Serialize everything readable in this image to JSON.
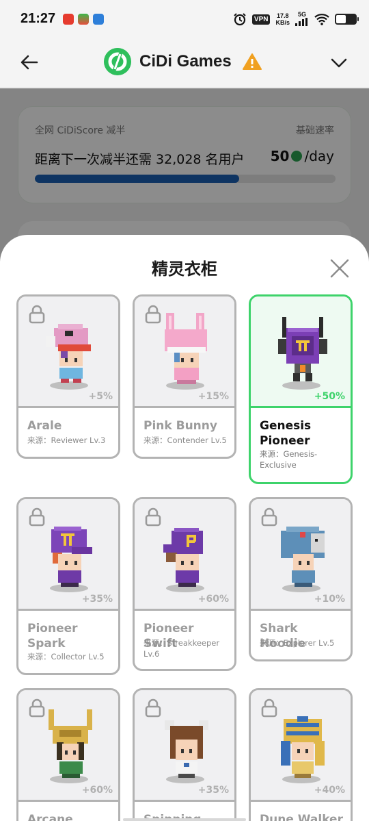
{
  "status_bar": {
    "time": "21:27",
    "vpn": "VPN",
    "speed_value": "17.8",
    "speed_unit": "KB/s",
    "network": "5G",
    "app_icons": [
      "app-red-icon",
      "app-game-icon",
      "app-blue-icon"
    ]
  },
  "header": {
    "title": "CiDi Games",
    "back_icon": "back-arrow-icon",
    "warning_icon": "warning-icon",
    "dropdown_icon": "chevron-down-icon",
    "brand_color": "#2fbf5c"
  },
  "score_card": {
    "label": "全网 CiDiScore 减半",
    "rate_label": "基础速率",
    "message": "距离下一次减半还需 32,028 名用户",
    "rate_value": "50",
    "rate_unit": "/day",
    "progress_fraction": 0.68,
    "progress_color": "#1b5fb3"
  },
  "sheet": {
    "title": "精灵衣柜",
    "close_icon": "close-icon",
    "selected_color": "#3ed36b",
    "items": [
      {
        "name": "Arale",
        "source": "来源：Reviewer Lv.3",
        "bonus": "+5%",
        "locked": true,
        "selected": false
      },
      {
        "name": "Pink Bunny",
        "source": "来源：Contender Lv.5",
        "bonus": "+15%",
        "locked": true,
        "selected": false
      },
      {
        "name": "Genesis Pioneer",
        "source": "来源：Genesis-Exclusive",
        "bonus": "+50%",
        "locked": false,
        "selected": true
      },
      {
        "name": "Pioneer Spark",
        "source": "来源：Collector Lv.5",
        "bonus": "+35%",
        "locked": true,
        "selected": false
      },
      {
        "name": "Pioneer Swift",
        "source": "来源：Streakkeeper Lv.6",
        "bonus": "+60%",
        "locked": true,
        "selected": false
      },
      {
        "name": "Shark Hoodie",
        "source": "来源：Explorer Lv.5",
        "bonus": "+10%",
        "locked": true,
        "selected": false
      },
      {
        "name": "Arcane Prince",
        "source": "",
        "bonus": "+60%",
        "locked": true,
        "selected": false
      },
      {
        "name": "Spinning",
        "source": "",
        "bonus": "+35%",
        "locked": true,
        "selected": false
      },
      {
        "name": "Dune Walker",
        "source": "",
        "bonus": "+40%",
        "locked": true,
        "selected": false
      }
    ]
  }
}
